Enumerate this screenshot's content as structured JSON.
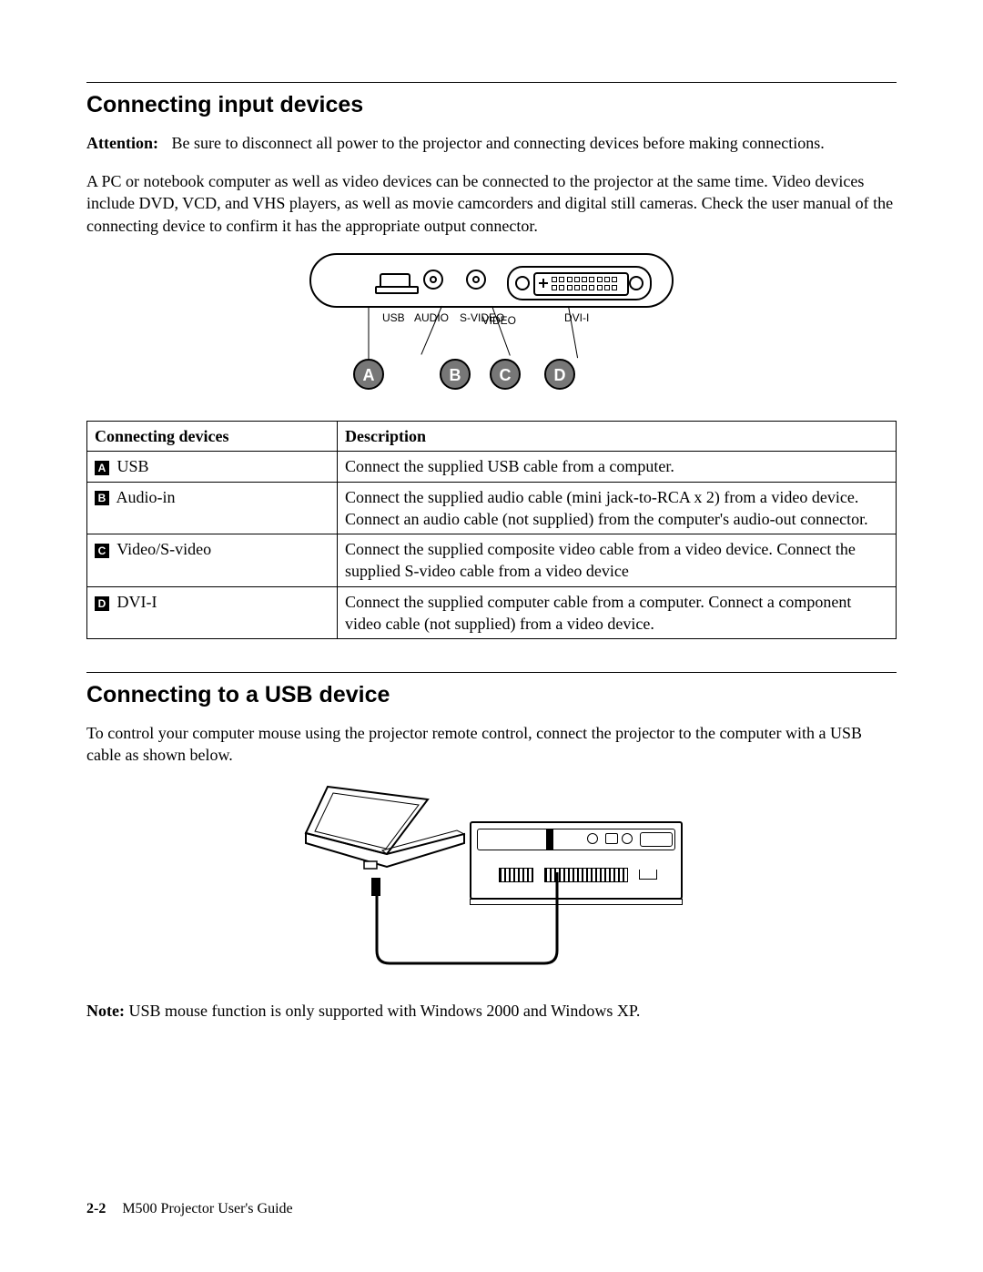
{
  "section1": {
    "heading": "Connecting input devices",
    "attention_label": "Attention:",
    "attention_text": "Be sure to disconnect all power to the projector and connecting devices before making connections.",
    "para2": "A PC or notebook computer as well as video devices can be connected to the projector at the same time. Video devices include DVD, VCD, and VHS players, as well as movie camcorders and digital still cameras. Check the user manual of the connecting device to confirm it has the appropriate output connector."
  },
  "panel_labels": {
    "usb": "USB",
    "audio": "AUDIO",
    "video_line1": "VIDEO",
    "video_line2": "S-VIDEO",
    "dvi": "DVI-I"
  },
  "callouts": {
    "A": "A",
    "B": "B",
    "C": "C",
    "D": "D"
  },
  "table": {
    "header_device": "Connecting devices",
    "header_desc": "Description",
    "rows": [
      {
        "letter": "A",
        "device": "USB",
        "desc": "Connect the supplied USB cable from a computer."
      },
      {
        "letter": "B",
        "device": "Audio-in",
        "desc": "Connect the supplied audio cable (mini jack-to-RCA x 2) from a video device. Connect an audio cable (not supplied) from the computer's audio-out connector."
      },
      {
        "letter": "C",
        "device": "Video/S-video",
        "desc": "Connect the supplied composite video cable from a video device. Connect the supplied S-video cable from a video device"
      },
      {
        "letter": "D",
        "device": "DVI-I",
        "desc": "Connect the supplied computer cable from a computer. Connect a component video cable (not supplied) from a video device."
      }
    ]
  },
  "section2": {
    "heading": "Connecting to a USB device",
    "para": "To control your computer mouse using the projector remote control, connect the projector to the computer with a USB cable as shown below.",
    "note_label": "Note:",
    "note_text": "USB mouse function is only supported with Windows 2000 and Windows XP."
  },
  "footer": {
    "page_num": "2-2",
    "doc_title": "M500 Projector User's Guide"
  }
}
